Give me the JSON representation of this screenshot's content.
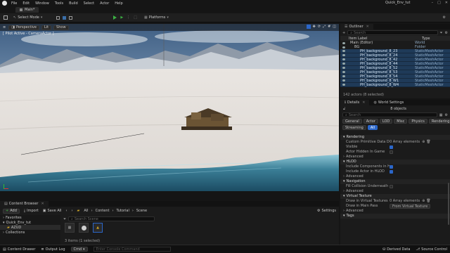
{
  "menu": [
    "File",
    "Edit",
    "Window",
    "Tools",
    "Build",
    "Select",
    "Actor",
    "Help"
  ],
  "project_name": "Quick_Env_tut",
  "level_tab": "Main*",
  "toolbar": {
    "select_mode": "Select Mode",
    "platforms": "Platforms"
  },
  "viewport": {
    "perspective": "Perspective",
    "lit": "Lit",
    "show": "Show",
    "pilot_label": "[ Pilot Active - CameraActor ]"
  },
  "outliner": {
    "tab": "Outliner",
    "search_placeholder": "Search",
    "col_label": "Item Label",
    "col_type": "Type",
    "rows": [
      {
        "label": "Main (Editor)",
        "type": "World"
      },
      {
        "label": "BG",
        "type": "Folder"
      },
      {
        "label": "PH_background_8_23",
        "type": "StaticMeshActor"
      },
      {
        "label": "PH_background_8_24",
        "type": "StaticMeshActor"
      },
      {
        "label": "PH_background_8_42",
        "type": "StaticMeshActor"
      },
      {
        "label": "PH_background_8_44",
        "type": "StaticMeshActor"
      },
      {
        "label": "PH_background_8_52",
        "type": "StaticMeshActor"
      },
      {
        "label": "PH_background_8_53",
        "type": "StaticMeshActor"
      },
      {
        "label": "PH_background_8_54",
        "type": "StaticMeshActor"
      },
      {
        "label": "PH_background_8_W1",
        "type": "StaticMeshActor"
      },
      {
        "label": "PH_background_8_W4",
        "type": "StaticMeshActor"
      }
    ],
    "footer": "142 actors (8 selected)"
  },
  "details": {
    "tab": "Details",
    "tab2": "World Settings",
    "count": "8 objects",
    "search_placeholder": "Search",
    "filters_row1": [
      "General",
      "Actor",
      "LOD",
      "Misc",
      "Physics",
      "Rendering"
    ],
    "filters_row2": [
      "Streaming",
      "All"
    ],
    "sections": {
      "rendering": "Rendering",
      "hlod": "HLOD",
      "navigation": "Navigation",
      "virtual_texture": "Virtual Texture",
      "tags": "Tags",
      "advanced": "Advanced"
    },
    "props": {
      "custom_prims": "Custom Primitive Data Defau...",
      "custom_prims_val": "0 Array elements",
      "visible": "Visible",
      "hidden_in_game": "Actor Hidden In Game",
      "include_hlod": "Include Components in HLOD",
      "include_actor_hlod": "Include Actor in HLOD",
      "fill_collision": "Fill Collision Underneath fo...",
      "draw_rvt": "Draw in Virtual Textures",
      "draw_rvt_val": "0 Array elements",
      "draw_main": "Draw in Main Pass",
      "draw_main_val": "From Virtual Texture"
    }
  },
  "content_browser": {
    "tab": "Content Browser",
    "add": "Add",
    "import": "Import",
    "save_all": "Save All",
    "path": [
      "All",
      "Content",
      "Tutorial",
      "Scene"
    ],
    "settings": "Settings",
    "favorites": "Favorites",
    "project": "Quick_Env_tut",
    "folder": "AZUD",
    "collections": "Collections",
    "search_placeholder": "Search Scene",
    "items_count": "3 items (1 selected)"
  },
  "statusbar": {
    "content_drawer": "Content Drawer",
    "output_log": "Output Log",
    "cmd": "Cmd",
    "cmd_placeholder": "Enter Console Command",
    "derived_data": "Derived Data",
    "source_control": "Source Control"
  },
  "colors": {
    "accent": "#2b66c9",
    "play": "#3cb043",
    "selection": "#1f3a58"
  }
}
